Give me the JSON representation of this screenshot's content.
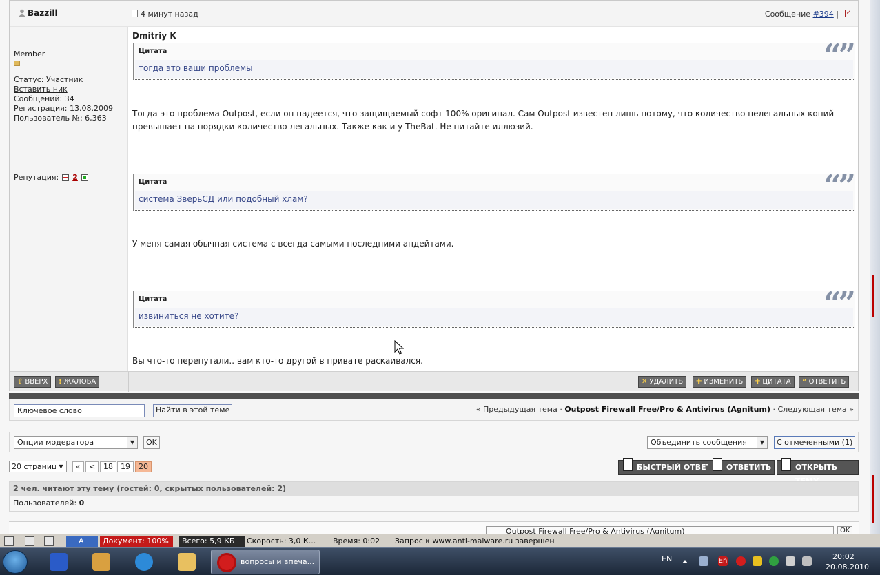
{
  "post": {
    "author": "Bazzill",
    "time": "4 минут назад",
    "message_label": "Сообщение",
    "message_number": "#394",
    "separator": "|",
    "profile": {
      "rank": "Member",
      "status": "Статус: Участник",
      "insert_nick": "Вставить ник",
      "messages": "Сообщений: 34",
      "registered": "Регистрация: 13.08.2009",
      "user_no": "Пользователь №: 6,363",
      "reputation_label": "Репутация:",
      "reputation_value": "2"
    },
    "quoted_author": "Dmitriy K",
    "quote_label": "Цитата",
    "quote_mark": "“”",
    "quotes": [
      "тогда это ваши проблемы",
      "система ЗверьСД или подобный хлам?",
      "извиниться не хотите?"
    ],
    "paragraphs": [
      "Тогда это проблема Outpost, если он надеется, что защищаемый софт 100% оригинал. Сам Outpost известен лишь потому, что количество нелегальных копий превышает на порядки количество легальных. Также как и у TheBat. Не питайте иллюзий.",
      "У меня самая обычная система с всегда самыми последними апдейтами.",
      "Вы что-то перепутали.. вам кто-то другой в привате раскаивался."
    ],
    "buttons": {
      "up": "ВВЕРХ",
      "report": "ЖАЛОБА",
      "delete": "УДАЛИТЬ",
      "edit": "ИЗМЕНИТЬ",
      "quote": "ЦИТАТА",
      "reply": "ОТВЕТИТЬ"
    }
  },
  "search": {
    "keyword_value": "Ключевое слово",
    "find_button": "Найти в этой теме",
    "prev_topic": "« Предыдущая тема ·",
    "topic_title": "Outpost Firewall Free/Pro & Antivirus (Agnitum)",
    "next_topic": "· Следующая тема »"
  },
  "moderation": {
    "options_select": "Опции модератора",
    "ok": "OK",
    "merge_select": "Объединить сообщения",
    "selected_button": "С отмеченными (1)"
  },
  "pagination": {
    "pages_select": "20 страниц",
    "first": "«",
    "prev": "<",
    "pages": [
      "18",
      "19",
      "20"
    ],
    "current": "20",
    "quick_reply": "БЫСТРЫЙ ОТВЕТ",
    "reply": "ОТВЕТИТЬ",
    "new_topic": "ОТКРЫТЬ ТЕМУ"
  },
  "readers": {
    "header": "2 чел. читают эту тему (гостей: 0, скрытых пользователей: 2)",
    "users_label": "Пользователей:",
    "users_count": "0"
  },
  "peek": {
    "forum_select": "Outpost Firewall Free/Pro & Antivirus (Agnitum)",
    "ok": "OK"
  },
  "statusbar": {
    "document": "Документ:",
    "document_value": "100%",
    "total": "Всего:",
    "total_value": "5,9 КБ",
    "speed": "Скорость:",
    "speed_value": "3,0 К...",
    "time": "Время:",
    "time_value": "0:02",
    "request": "Запрос к www.anti-malware.ru завершен",
    "a_label": "A"
  },
  "taskbar": {
    "opera_task": "вопросы и впеча...",
    "lang": "EN",
    "tray_lang": "En",
    "time": "20:02",
    "date": "20.08.2010"
  },
  "colors": {
    "accent_red": "#c41a1a",
    "button_grey": "#6b6b6b",
    "quote_text": "#3a4a8a",
    "current_page": "#f5b896"
  }
}
